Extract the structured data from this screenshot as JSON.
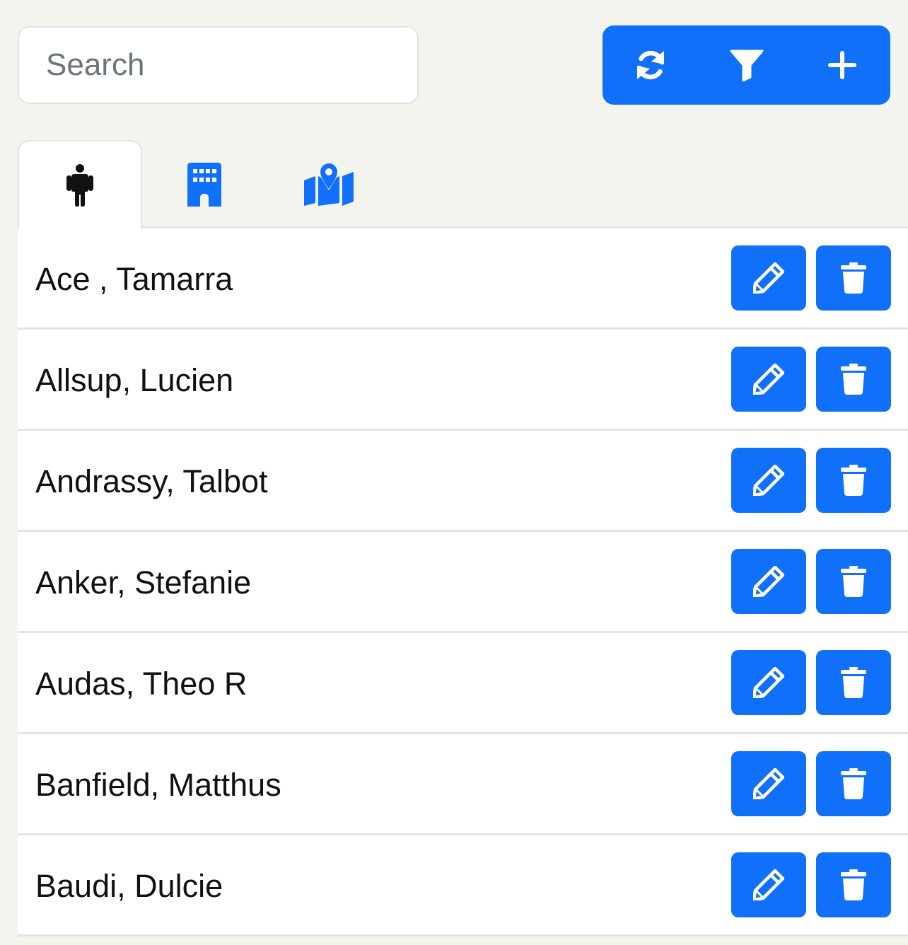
{
  "search": {
    "placeholder": "Search",
    "value": ""
  },
  "toolbar": {
    "buttons": [
      {
        "icon": "sync-icon"
      },
      {
        "icon": "filter-icon"
      },
      {
        "icon": "plus-icon"
      }
    ]
  },
  "tabs": [
    {
      "icon": "person-icon",
      "active": true
    },
    {
      "icon": "building-icon",
      "active": false
    },
    {
      "icon": "map-marker-icon",
      "active": false
    }
  ],
  "people": [
    {
      "name": "Ace , Tamarra"
    },
    {
      "name": "Allsup, Lucien"
    },
    {
      "name": "Andrassy, Talbot"
    },
    {
      "name": "Anker, Stefanie"
    },
    {
      "name": "Audas, Theo R"
    },
    {
      "name": "Banfield, Matthus"
    },
    {
      "name": "Baudi, Dulcie"
    }
  ],
  "colors": {
    "accent": "#1170fa",
    "background": "#f4f4ef",
    "active_tab_icon": "#111111"
  }
}
